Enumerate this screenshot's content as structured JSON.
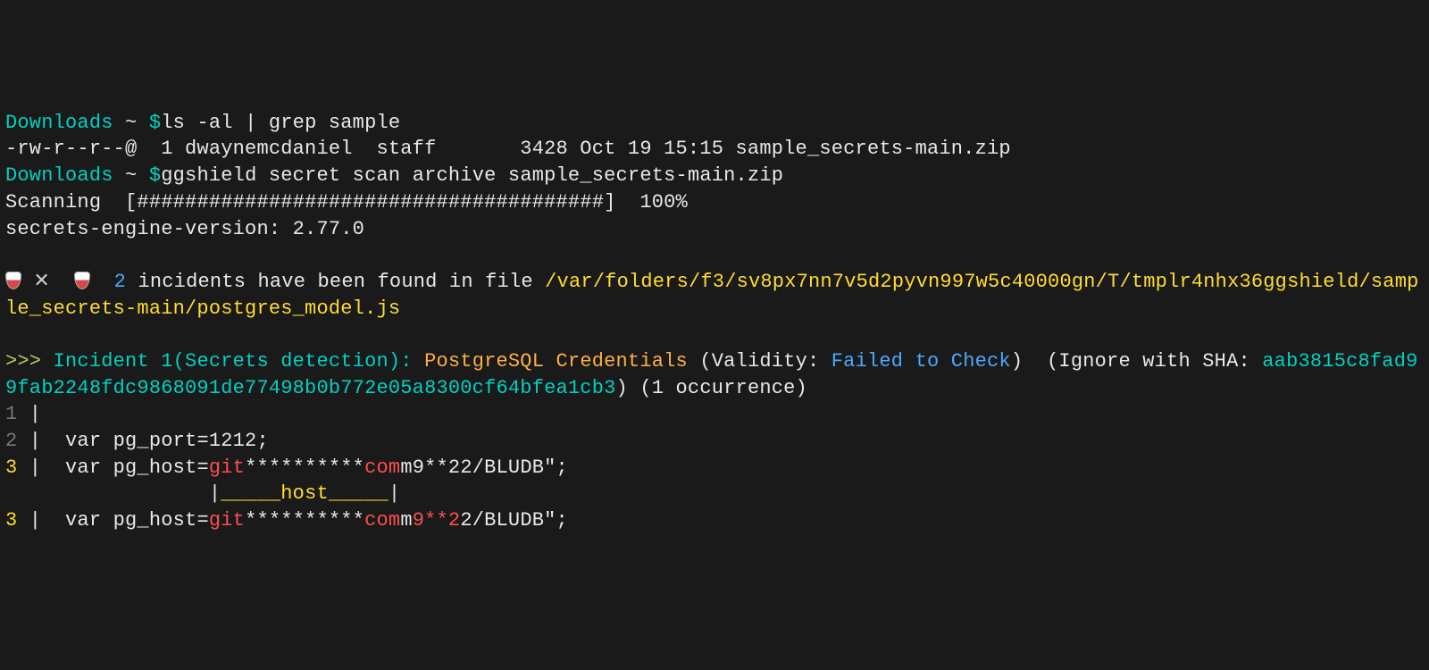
{
  "prompt1": {
    "cwd": "Downloads",
    "sep": "~",
    "sigil": "$",
    "cmd": "ls -al | grep sample"
  },
  "ls_out": "-rw-r--r--@  1 dwaynemcdaniel  staff       3428 Oct 19 15:15 sample_secrets-main.zip",
  "prompt2": {
    "cwd": "Downloads",
    "sep": "~",
    "sigil": "$",
    "cmd": "ggshield secret scan archive sample_secrets-main.zip"
  },
  "scan": {
    "label": "Scanning  ",
    "bar": "[#######################################]",
    "pct": "  100%"
  },
  "engine": "secrets-engine-version: 2.77.0",
  "summary": {
    "count": "2",
    "msg": " incidents have been found in file ",
    "path": "/var/folders/f3/sv8px7nn7v5d2pyvn997w5c40000gn/T/tmplr4nhx36ggshield/sample_secrets-main/postgres_model.js"
  },
  "inc1": {
    "chev": ">>>",
    "h1": " Incident 1(Secrets detection): ",
    "type": "PostgreSQL Credentials",
    "v1": " (Validity: ",
    "v2": "Failed to Check",
    "v3": ")  (Ignore with SHA: ",
    "sha": "aab3815c8fad99fab2248fdc9868091de77498b0b772e05a8300cf64bfea1cb3",
    "tail": ") (1 occurrence)"
  },
  "code": {
    "l1n": "1",
    "l1": " |",
    "l2n": "2",
    "l2": " |  var pg_port=1212;",
    "l3n": "3",
    "l3a": " |  var pg_host=",
    "l3b": "git",
    "l3c": "**********",
    "l3d": "com",
    "l3e": "m9**22/BLUDB\";",
    "u1": "                 |",
    "u2": "_____",
    "u3": "host",
    "u4": "_____",
    "u5": "|",
    "l4n": "3",
    "l4a": " |  var pg_host=",
    "l4b": "git",
    "l4c": "**********",
    "l4d": "com",
    "l4e": "m",
    "l4f": "9**2",
    "l4g": "2/BLUDB\";"
  }
}
